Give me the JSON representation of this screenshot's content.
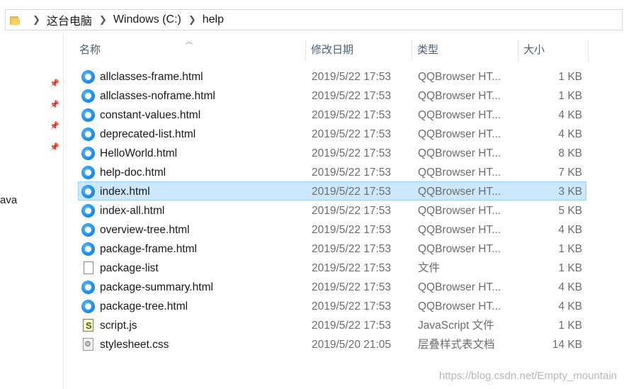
{
  "address_bar": {
    "crumbs": [
      "这台电脑",
      "Windows (C:)",
      "help"
    ]
  },
  "nav": {
    "partial_item": "ava"
  },
  "columns": {
    "name": "名称",
    "date": "修改日期",
    "type": "类型",
    "size": "大小"
  },
  "files": [
    {
      "name": "allclasses-frame.html",
      "date": "2019/5/22 17:53",
      "type": "QQBrowser HT...",
      "size": "1 KB",
      "icon": "browser-icon"
    },
    {
      "name": "allclasses-noframe.html",
      "date": "2019/5/22 17:53",
      "type": "QQBrowser HT...",
      "size": "1 KB",
      "icon": "browser-icon"
    },
    {
      "name": "constant-values.html",
      "date": "2019/5/22 17:53",
      "type": "QQBrowser HT...",
      "size": "4 KB",
      "icon": "browser-icon"
    },
    {
      "name": "deprecated-list.html",
      "date": "2019/5/22 17:53",
      "type": "QQBrowser HT...",
      "size": "4 KB",
      "icon": "browser-icon"
    },
    {
      "name": "HelloWorld.html",
      "date": "2019/5/22 17:53",
      "type": "QQBrowser HT...",
      "size": "8 KB",
      "icon": "browser-icon"
    },
    {
      "name": "help-doc.html",
      "date": "2019/5/22 17:53",
      "type": "QQBrowser HT...",
      "size": "7 KB",
      "icon": "browser-icon"
    },
    {
      "name": "index.html",
      "date": "2019/5/22 17:53",
      "type": "QQBrowser HT...",
      "size": "3 KB",
      "icon": "browser-icon",
      "selected": true
    },
    {
      "name": "index-all.html",
      "date": "2019/5/22 17:53",
      "type": "QQBrowser HT...",
      "size": "5 KB",
      "icon": "browser-icon"
    },
    {
      "name": "overview-tree.html",
      "date": "2019/5/22 17:53",
      "type": "QQBrowser HT...",
      "size": "4 KB",
      "icon": "browser-icon"
    },
    {
      "name": "package-frame.html",
      "date": "2019/5/22 17:53",
      "type": "QQBrowser HT...",
      "size": "1 KB",
      "icon": "browser-icon"
    },
    {
      "name": "package-list",
      "date": "2019/5/22 17:53",
      "type": "文件",
      "size": "1 KB",
      "icon": "blank-file-icon"
    },
    {
      "name": "package-summary.html",
      "date": "2019/5/22 17:53",
      "type": "QQBrowser HT...",
      "size": "4 KB",
      "icon": "browser-icon"
    },
    {
      "name": "package-tree.html",
      "date": "2019/5/22 17:53",
      "type": "QQBrowser HT...",
      "size": "4 KB",
      "icon": "browser-icon"
    },
    {
      "name": "script.js",
      "date": "2019/5/22 17:53",
      "type": "JavaScript 文件",
      "size": "1 KB",
      "icon": "javascript-file-icon"
    },
    {
      "name": "stylesheet.css",
      "date": "2019/5/20 21:05",
      "type": "层叠样式表文档",
      "size": "14 KB",
      "icon": "css-file-icon"
    }
  ],
  "watermark": "https://blog.csdn.net/Empty_mountain"
}
